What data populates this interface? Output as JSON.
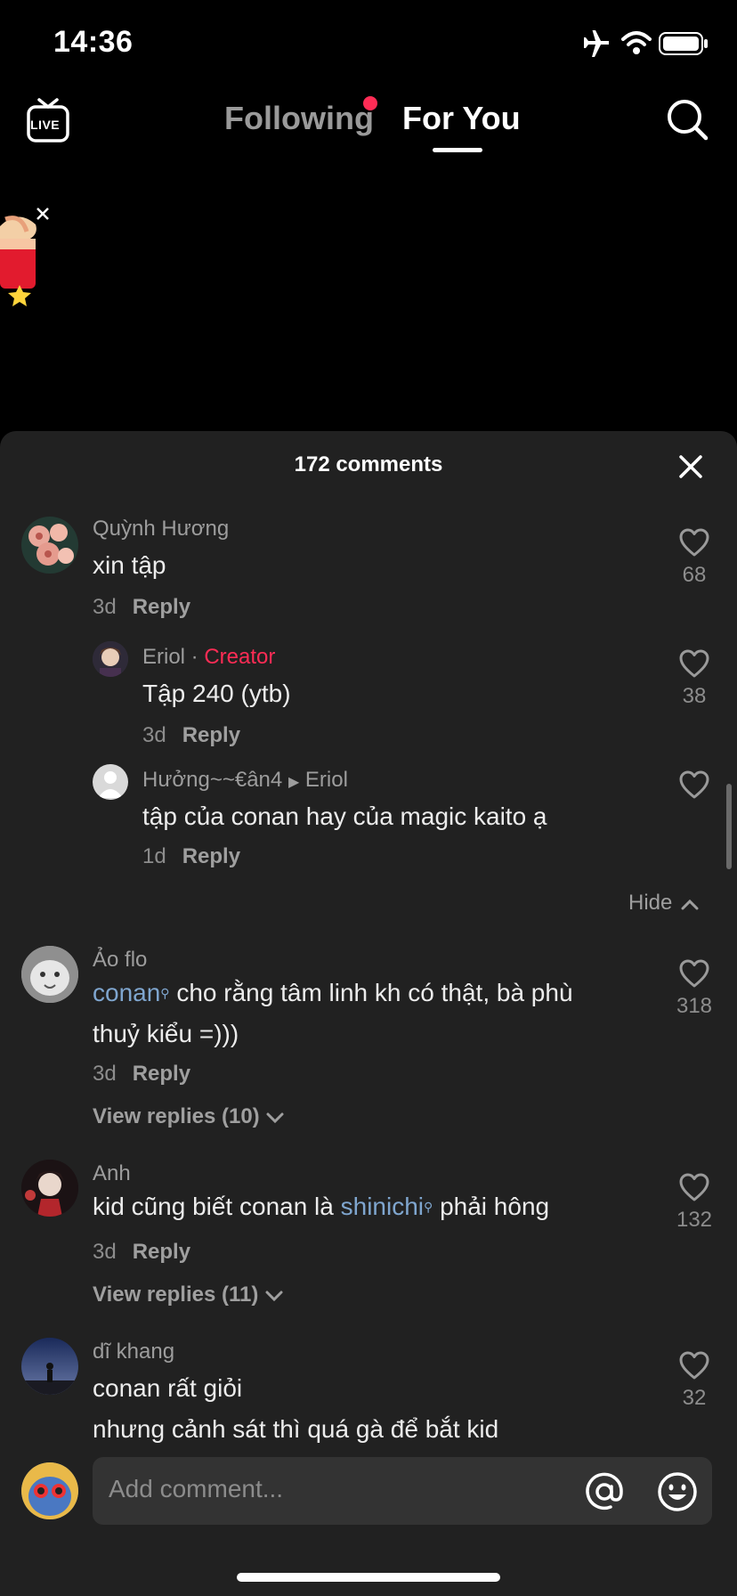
{
  "status_bar": {
    "time": "14:36"
  },
  "top_nav": {
    "live_label": "LIVE",
    "tabs": [
      "Following",
      "For You"
    ],
    "active_tab": "For You"
  },
  "comments_sheet": {
    "title": "172 comments",
    "comments": [
      {
        "user": "Quỳnh Hương",
        "text": "xin tập",
        "time": "3d",
        "reply": "Reply",
        "likes": "68"
      },
      {
        "user": "Eriol",
        "badge": "Creator",
        "text": "Tập 240 (ytb)",
        "time": "3d",
        "reply": "Reply",
        "likes": "38"
      },
      {
        "user": "Hưởng~~€ân4",
        "reply_to": "Eriol",
        "text": "tập của conan hay của magic kaito ạ",
        "time": "1d",
        "reply": "Reply"
      },
      {
        "hide": "Hide"
      },
      {
        "user": "Ảo flo",
        "mention": "conan",
        "text_line1": " cho rằng tâm linh kh có thật, bà phù",
        "text_line2": "thuỷ kiểu =)))",
        "time": "3d",
        "reply": "Reply",
        "likes": "318",
        "view_replies": "View replies (10)"
      },
      {
        "user": "Anh",
        "text_before": "kid cũng biết conan là ",
        "mention": "shinichi",
        "text_after": " phải hông",
        "time": "3d",
        "reply": "Reply",
        "likes": "132",
        "view_replies": "View replies (11)"
      },
      {
        "user": "dĩ khang",
        "text_line1": "conan rất giỏi",
        "text_line2": "nhưng cảnh sát thì quá gà để bắt kid",
        "likes": "32"
      }
    ]
  },
  "composer": {
    "placeholder": "Add comment..."
  },
  "colors": {
    "accent": "#fe2c55",
    "sheet_bg": "#212121",
    "link": "#7fa6cf"
  }
}
